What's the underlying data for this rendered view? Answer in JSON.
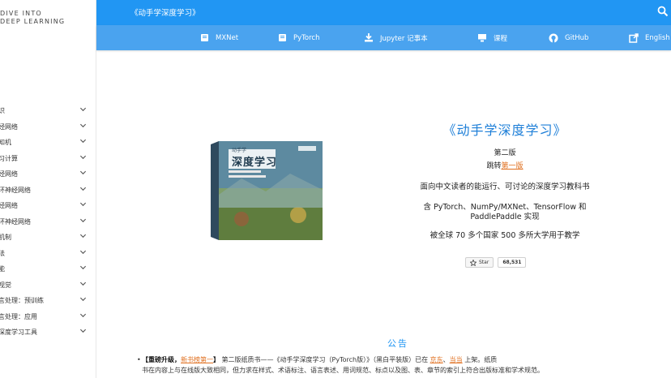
{
  "sidebar": {
    "logo_line1": "DIVE INTO",
    "logo_line2": "DEEP LEARNING",
    "items": [
      {
        "label": "识"
      },
      {
        "label": "经网络"
      },
      {
        "label": "知机"
      },
      {
        "label": "习计算"
      },
      {
        "label": "经网络"
      },
      {
        "label": "环神经网络"
      },
      {
        "label": "经网络"
      },
      {
        "label": "环神经网络"
      },
      {
        "label": "机制"
      },
      {
        "label": "法"
      },
      {
        "label": "能"
      },
      {
        "label": "视觉"
      },
      {
        "label": "言处理：预训练"
      },
      {
        "label": "言处理：应用"
      },
      {
        "label": "深度学习工具"
      }
    ]
  },
  "header": {
    "title": "《动手学深度学习》"
  },
  "navbar": {
    "links": [
      {
        "label": "MXNet",
        "icon": "book-icon"
      },
      {
        "label": "PyTorch",
        "icon": "book-icon"
      },
      {
        "label": "Jupyter 记事本",
        "icon": "download-icon"
      },
      {
        "label": "课程",
        "icon": "course-icon"
      },
      {
        "label": "GitHub",
        "icon": "github-icon"
      },
      {
        "label": "English",
        "icon": "external-link-icon"
      }
    ]
  },
  "hero": {
    "title": "《动手学深度学习》",
    "edition": "第二版",
    "jump_prefix": "跳转",
    "jump_link": "第一版",
    "description": "面向中文读者的能运行、可讨论的深度学习教科书",
    "frameworks": "含 PyTorch、NumPy/MXNet、TensorFlow 和 PaddlePaddle 实现",
    "adoption": "被全球 70 多个国家 500 多所大学用于教学",
    "star_label": "Star",
    "star_count": "68,531"
  },
  "book_cover": {
    "title": "深度学习",
    "subtitle": "动手学"
  },
  "announcement": {
    "title": "公告",
    "bold": "【重磅升级，",
    "link1": "新书榜第一",
    "bold_end": "】",
    "text1": " 第二版纸质书——《动手学深度学习（PyTorch版）》（黑白平装版）已在 ",
    "link2": "京东",
    "sep": "、",
    "link3": "当当",
    "text2": " 上架。纸质",
    "line2": "书在内容上与在线版大致相同，但力求在样式、术语标注、语言表述、用词规范、标点以及图、表、章节的索引上符合出版标准和学术规范。"
  },
  "colors": {
    "topbar": "#2196f3",
    "navbar": "#4aa3ef",
    "accent_link": "#e07020",
    "title_blue": "#1e7fd8"
  }
}
